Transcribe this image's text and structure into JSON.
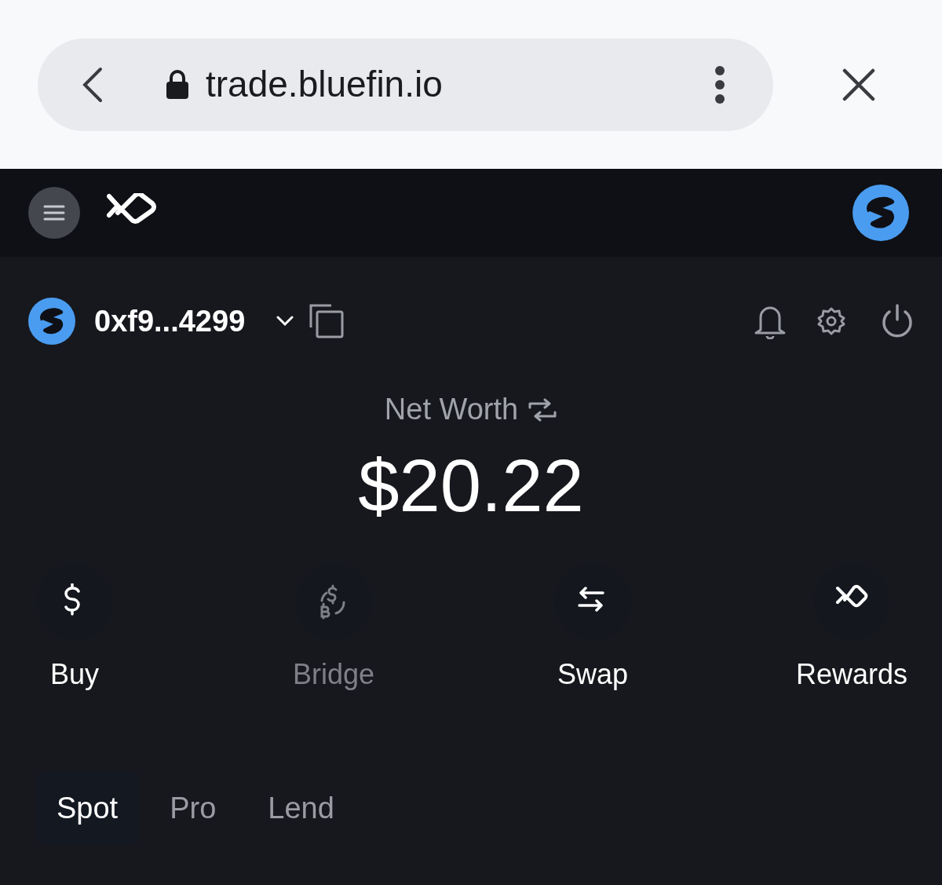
{
  "browser": {
    "url": "trade.bluefin.io"
  },
  "wallet": {
    "address": "0xf9...4299"
  },
  "net_worth": {
    "label": "Net Worth",
    "value": "$20.22"
  },
  "actions": [
    {
      "label": "Buy",
      "disabled": false
    },
    {
      "label": "Bridge",
      "disabled": true
    },
    {
      "label": "Swap",
      "disabled": false
    },
    {
      "label": "Rewards",
      "disabled": false
    }
  ],
  "tabs": [
    {
      "label": "Spot",
      "selected": true
    },
    {
      "label": "Pro",
      "selected": false
    },
    {
      "label": "Lend",
      "selected": false
    }
  ]
}
